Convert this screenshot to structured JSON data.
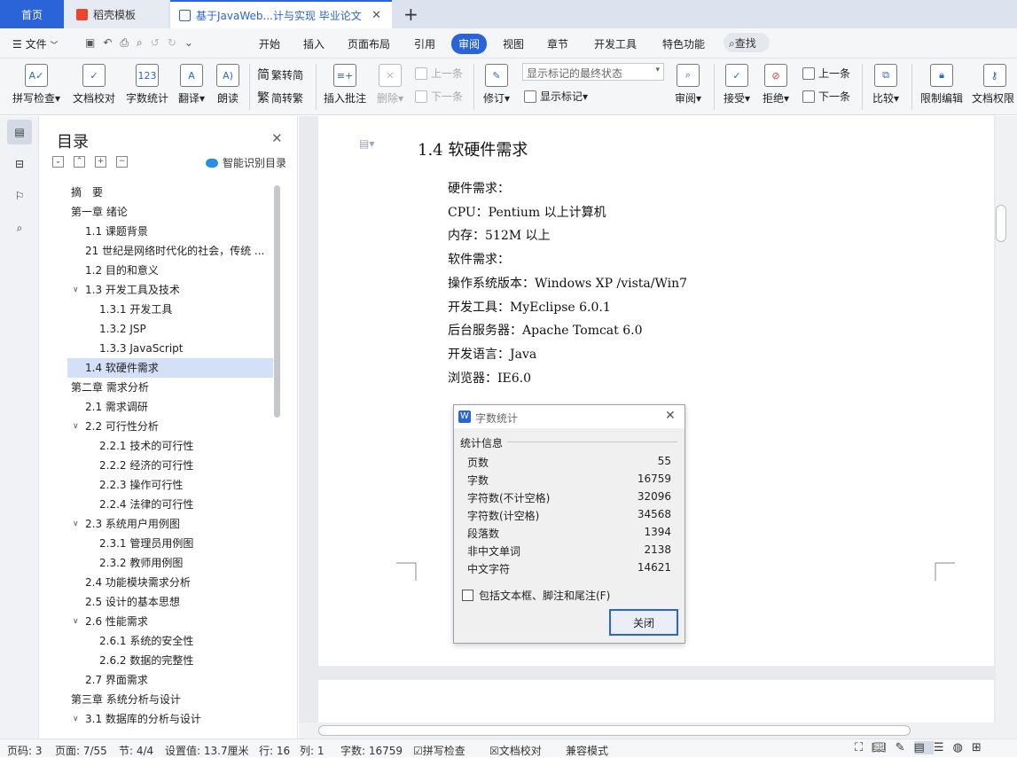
{
  "tabs": {
    "home": "首页",
    "docer": "稻壳模板",
    "document": "基于JavaWeb...计与实现 毕业论文"
  },
  "menu": {
    "file": "文件",
    "items": [
      "开始",
      "插入",
      "页面布局",
      "引用",
      "审阅",
      "视图",
      "章节",
      "开发工具",
      "特色功能"
    ],
    "search": "查找"
  },
  "ribbon": {
    "spell_check": "拼写检查",
    "doc_proofread": "文档校对",
    "word_count": "字数统计",
    "translate": "翻译",
    "read_aloud": "朗读",
    "trad_simp": "繁转简",
    "simp_trad": "简转繁",
    "insert_comment": "插入批注",
    "delete": "删除",
    "prev_comment": "上一条",
    "next_comment": "下一条",
    "track_changes": "修订",
    "markup_state": "显示标记的最终状态",
    "show_markup": "显示标记",
    "review": "审阅",
    "accept": "接受",
    "reject": "拒绝",
    "prev_change": "上一条",
    "next_change": "下一条",
    "compare": "比较",
    "restrict_edit": "限制编辑",
    "doc_permission": "文档权限"
  },
  "nav": {
    "title": "目录",
    "smart_toc": "智能识别目录",
    "toc": [
      {
        "label": "摘　要",
        "level": 0,
        "toggle": ""
      },
      {
        "label": "第一章  绪论",
        "level": 0,
        "toggle": "open"
      },
      {
        "label": "1.1 课题背景",
        "level": 1,
        "toggle": ""
      },
      {
        "label": "21 世纪是网络时代化的社会，传统 ...",
        "level": 1,
        "toggle": ""
      },
      {
        "label": "1.2 目的和意义",
        "level": 1,
        "toggle": ""
      },
      {
        "label": "1.3 开发工具及技术",
        "level": 1,
        "toggle": "open"
      },
      {
        "label": "1.3.1 开发工具",
        "level": 2,
        "toggle": ""
      },
      {
        "label": "1.3.2 JSP",
        "level": 2,
        "toggle": ""
      },
      {
        "label": "1.3.3 JavaScript",
        "level": 2,
        "toggle": ""
      },
      {
        "label": "1.4 软硬件需求",
        "level": 1,
        "toggle": "",
        "selected": true
      },
      {
        "label": "第二章  需求分析",
        "level": 0,
        "toggle": "open"
      },
      {
        "label": "2.1 需求调研",
        "level": 1,
        "toggle": ""
      },
      {
        "label": "2.2 可行性分析",
        "level": 1,
        "toggle": "open"
      },
      {
        "label": "2.2.1 技术的可行性",
        "level": 2,
        "toggle": ""
      },
      {
        "label": "2.2.2 经济的可行性",
        "level": 2,
        "toggle": ""
      },
      {
        "label": "2.2.3 操作可行性",
        "level": 2,
        "toggle": ""
      },
      {
        "label": "2.2.4 法律的可行性",
        "level": 2,
        "toggle": ""
      },
      {
        "label": "2.3 系统用户用例图",
        "level": 1,
        "toggle": "open"
      },
      {
        "label": "2.3.1 管理员用例图",
        "level": 2,
        "toggle": ""
      },
      {
        "label": "2.3.2 教师用例图",
        "level": 2,
        "toggle": ""
      },
      {
        "label": "2.4 功能模块需求分析",
        "level": 1,
        "toggle": ""
      },
      {
        "label": "2.5 设计的基本思想",
        "level": 1,
        "toggle": ""
      },
      {
        "label": "2.6 性能需求",
        "level": 1,
        "toggle": "open"
      },
      {
        "label": "2.6.1 系统的安全性",
        "level": 2,
        "toggle": ""
      },
      {
        "label": "2.6.2 数据的完整性",
        "level": 2,
        "toggle": ""
      },
      {
        "label": "2.7 界面需求",
        "level": 1,
        "toggle": ""
      },
      {
        "label": "第三章  系统分析与设计",
        "level": 0,
        "toggle": "open"
      },
      {
        "label": "3.1 数据库的分析与设计",
        "level": 1,
        "toggle": "open"
      }
    ]
  },
  "document": {
    "heading": "1.4 软硬件需求",
    "lines": [
      "硬件需求：",
      "CPU：Pentium 以上计算机",
      "内存：512M 以上",
      "软件需求：",
      "操作系统版本：Windows XP /vista/Win7",
      "开发工具：MyEclipse 6.0.1",
      "后台服务器：Apache Tomcat 6.0",
      "开发语言：Java",
      "浏览器：IE6.0"
    ]
  },
  "dialog": {
    "title": "字数统计",
    "group": "统计信息",
    "stats": [
      {
        "label": "页数",
        "value": "55"
      },
      {
        "label": "字数",
        "value": "16759"
      },
      {
        "label": "字符数(不计空格)",
        "value": "32096"
      },
      {
        "label": "字符数(计空格)",
        "value": "34568"
      },
      {
        "label": "段落数",
        "value": "1394"
      },
      {
        "label": "非中文单词",
        "value": "2138"
      },
      {
        "label": "中文字符",
        "value": "14621"
      }
    ],
    "checkbox": "包括文本框、脚注和尾注(F)",
    "close": "关闭"
  },
  "status": {
    "page_code": "页码: 3",
    "page": "页面: 7/55",
    "section": "节: 4/4",
    "setting": "设置值: 13.7厘米",
    "row": "行: 16",
    "col": "列: 1",
    "words": "字数: 16759",
    "spell": "拼写检查",
    "proof": "文档校对",
    "compat": "兼容模式"
  },
  "colors": {
    "accent": "#2b63d9",
    "selection": "#d3e0f8"
  }
}
